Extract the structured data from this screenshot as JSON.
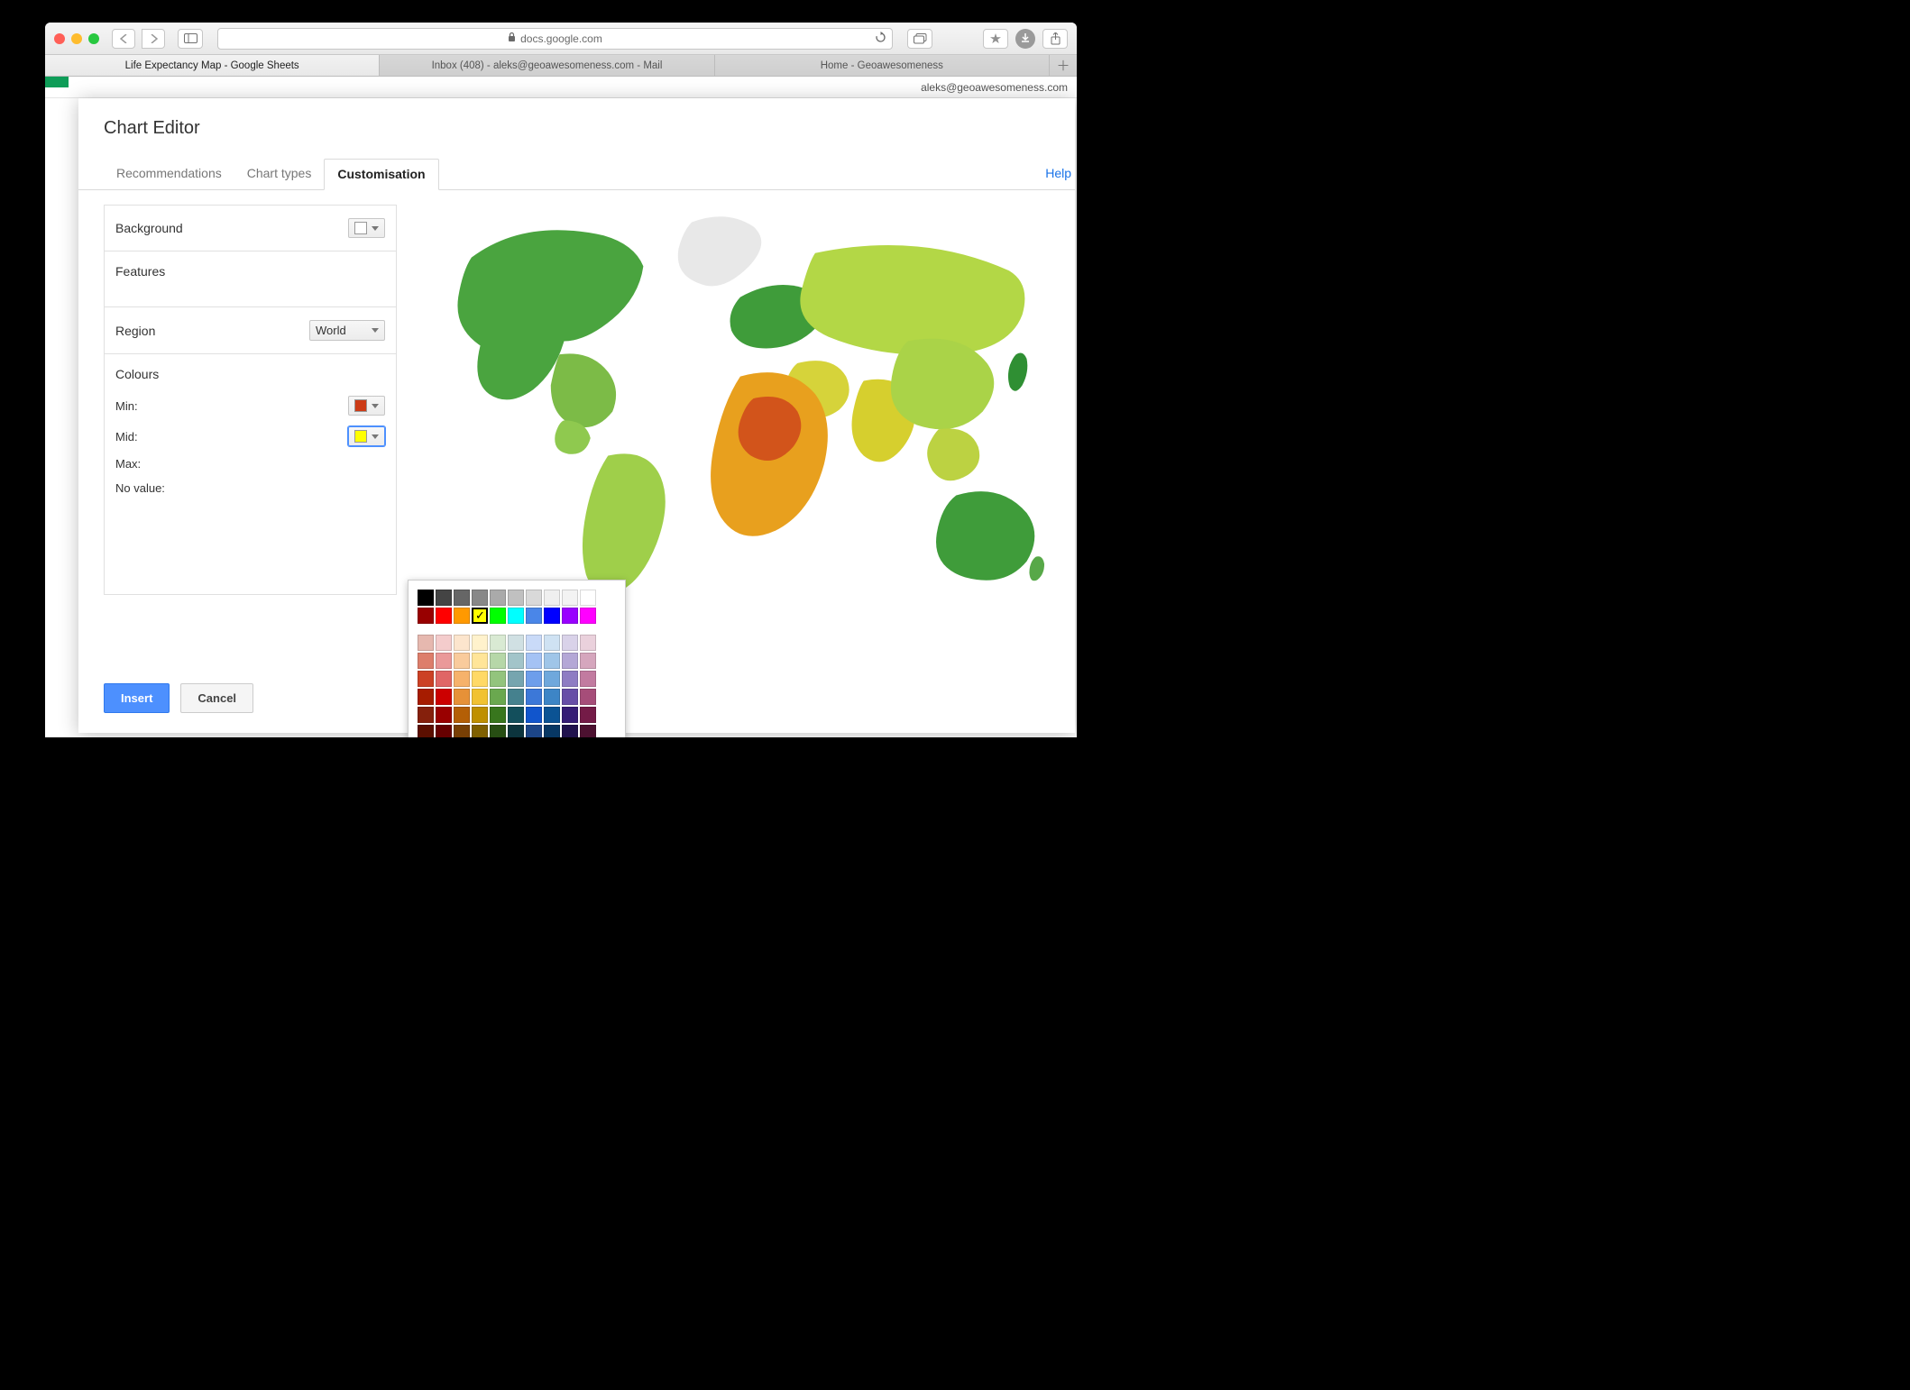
{
  "browser": {
    "url_host": "docs.google.com",
    "tabs": [
      {
        "label": "Life Expectancy Map - Google Sheets",
        "active": true
      },
      {
        "label": "Inbox (408) - aleks@geoawesomeness.com - Mail",
        "active": false
      },
      {
        "label": "Home - Geoawesomeness",
        "active": false
      }
    ]
  },
  "docbar": {
    "user": "aleks@geoawesomeness.com"
  },
  "chart_editor": {
    "title": "Chart Editor",
    "help": "Help",
    "tabs": {
      "recommendations": "Recommendations",
      "chart_types": "Chart types",
      "customisation": "Customisation"
    },
    "panel": {
      "background": "Background",
      "features": "Features",
      "region": "Region",
      "region_value": "World",
      "colours": {
        "title": "Colours",
        "min": "Min:",
        "mid": "Mid:",
        "max": "Max:",
        "no_value": "No value:",
        "min_color": "#cc3b16",
        "mid_color": "#ffff00"
      }
    },
    "buttons": {
      "insert": "Insert",
      "cancel": "Cancel"
    }
  },
  "color_picker": {
    "grays": [
      "#000000",
      "#444444",
      "#666666",
      "#888888",
      "#aaaaaa",
      "#c0c0c0",
      "#d9d9d9",
      "#efefef",
      "#f3f3f3",
      "#ffffff"
    ],
    "standard": [
      "#980000",
      "#ff0000",
      "#ff9900",
      "#ffff00",
      "#00ff00",
      "#00ffff",
      "#4a86e8",
      "#0000ff",
      "#9900ff",
      "#ff00ff"
    ],
    "selected": "#ffff00",
    "shades": [
      [
        "#e6b8af",
        "#f4cccc",
        "#fce5cd",
        "#fff2cc",
        "#d9ead3",
        "#d0e0e3",
        "#c9daf8",
        "#cfe2f3",
        "#d9d2e9",
        "#ead1dc"
      ],
      [
        "#dd7e6b",
        "#ea9999",
        "#f9cb9c",
        "#ffe599",
        "#b6d7a8",
        "#a2c4c9",
        "#a4c2f4",
        "#9fc5e8",
        "#b4a7d6",
        "#d5a6bd"
      ],
      [
        "#cc4125",
        "#e06666",
        "#f6b26b",
        "#ffd966",
        "#93c47d",
        "#76a5af",
        "#6d9eeb",
        "#6fa8dc",
        "#8e7cc3",
        "#c27ba0"
      ],
      [
        "#a61c00",
        "#cc0000",
        "#e69138",
        "#f1c232",
        "#6aa84f",
        "#45818e",
        "#3c78d8",
        "#3d85c6",
        "#674ea7",
        "#a64d79"
      ],
      [
        "#85200c",
        "#990000",
        "#b45f06",
        "#bf9000",
        "#38761d",
        "#134f5c",
        "#1155cc",
        "#0b5394",
        "#351c75",
        "#741b47"
      ],
      [
        "#5b0f00",
        "#660000",
        "#783f04",
        "#7f6000",
        "#274e13",
        "#0c343d",
        "#1c4587",
        "#073763",
        "#20124d",
        "#4c1130"
      ]
    ]
  }
}
